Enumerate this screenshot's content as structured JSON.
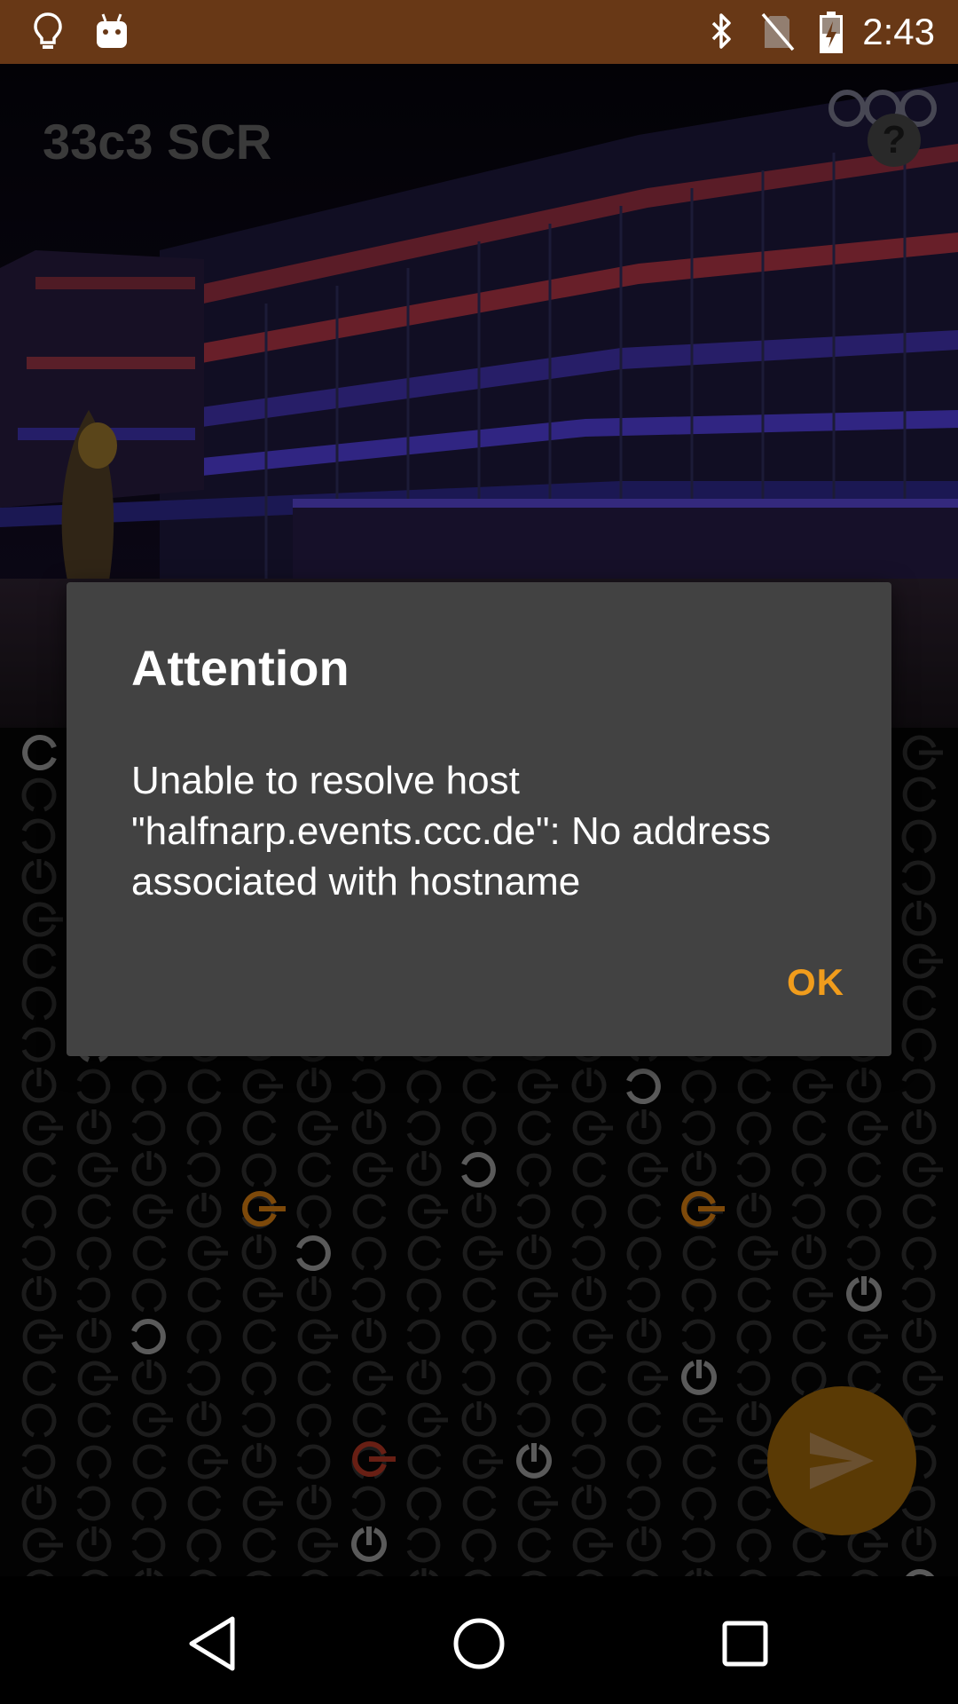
{
  "status_bar": {
    "time": "2:43",
    "left_icons": [
      "lightbulb-icon",
      "android-icon"
    ],
    "right_icons": [
      "bluetooth-icon",
      "no-sim-icon",
      "battery-charging-icon"
    ]
  },
  "app": {
    "title": "33c3 SCR",
    "help_label": "?"
  },
  "dialog": {
    "title": "Attention",
    "message": "Unable to resolve host \"halfnarp.events.ccc.de\": No address associated with hostname",
    "ok_label": "OK"
  },
  "fab": {
    "icon": "send-icon",
    "color": "#5a3a05"
  },
  "nav_bar": {
    "buttons": [
      "back-icon",
      "home-icon",
      "recents-icon"
    ]
  },
  "colors": {
    "status_bar": "#683816",
    "dialog_background": "#424242",
    "accent": "#f09c1c"
  }
}
